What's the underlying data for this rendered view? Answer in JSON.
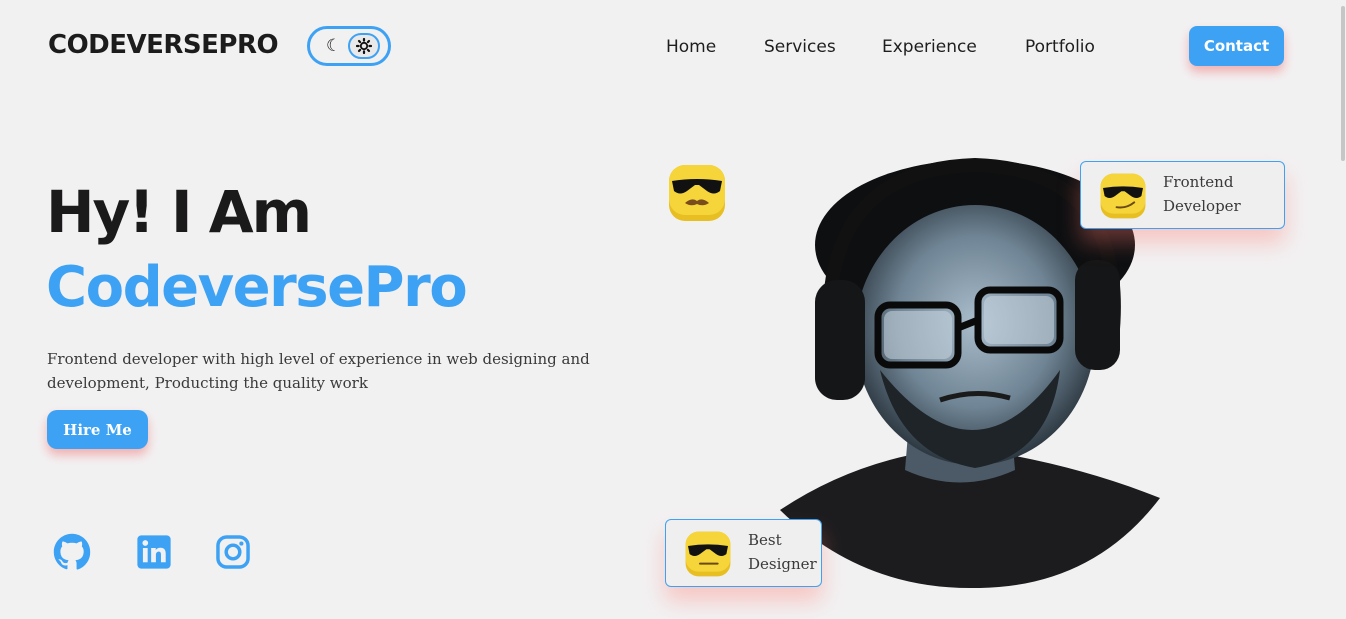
{
  "header": {
    "logo": "CODEVERSEPRO",
    "theme_toggle": {
      "moon_icon": "moon-icon",
      "sun_icon": "sun-icon"
    },
    "nav": [
      {
        "label": "Home"
      },
      {
        "label": "Services"
      },
      {
        "label": "Experience"
      },
      {
        "label": "Portfolio"
      }
    ],
    "contact_label": "Contact"
  },
  "hero": {
    "greeting": "Hy! I Am",
    "name": "CodeversePro",
    "description": "Frontend developer with high level of experience in web designing and development, Producting the quality work",
    "hire_label": "Hire Me",
    "socials": [
      {
        "icon": "github-icon"
      },
      {
        "icon": "linkedin-icon"
      },
      {
        "icon": "instagram-icon"
      }
    ]
  },
  "badges": {
    "frontend": {
      "line1": "Frontend",
      "line2": "Developer"
    },
    "designer": {
      "line1": "Best",
      "line2": "Designer"
    }
  },
  "colors": {
    "accent": "#3ea2f4",
    "background": "#f2f1f2",
    "text": "#1b1b1b",
    "emoji_yellow": "#f5d53a"
  }
}
